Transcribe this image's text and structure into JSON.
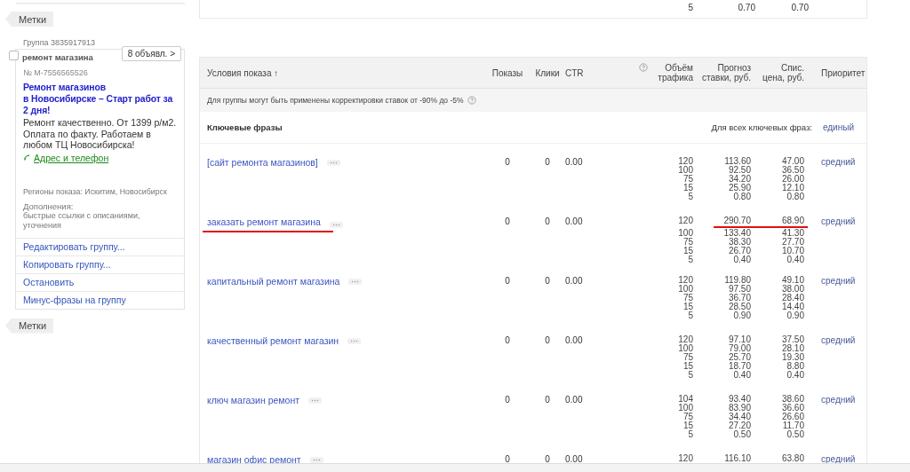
{
  "sidebar": {
    "tags_top": "Метки",
    "group": {
      "label": "Группа 3835917913",
      "name": "ремонт магазина",
      "checked": false,
      "ads_button": "8 объявл. >"
    },
    "ad": {
      "number": "№ M-7556565526",
      "title": "Ремонт магазинов\nв Новосибирске – Старт работ за 2 дня!",
      "text": "Ремонт качественно. От 1399 р/м2. Оплата по факту. Работаем в любом ТЦ Новосибирска!",
      "contact_link": "Адрес и телефон",
      "regions": "Регионы показа: Искитим, Новосибирск",
      "extras_label": "Дополнения:",
      "extras": "быстрые ссылки с описаниями, уточнения"
    },
    "menu": [
      "Редактировать группу...",
      "Копировать группу...",
      "Остановить",
      "Минус-фразы на группу"
    ],
    "tags_bottom": "Метки"
  },
  "previous_row": {
    "volume": "5",
    "bid": "0.70",
    "price": "0.70"
  },
  "table": {
    "columns": {
      "conditions": "Условия показа ↑",
      "shows": "Показы",
      "clicks": "Клики",
      "ctr": "CTR",
      "volume": "Объём трафика",
      "forecast": "Прогноз ставки, руб.",
      "price": "Спис. цена, руб.",
      "priority": "Приоритет"
    },
    "notice": "Для группы могут быть применены корректировки ставок от -90% до -5%",
    "section": "Ключевые фразы",
    "all_phrases_label": "Для всех ключевых фраз:",
    "all_phrases_priority": "единый",
    "rows": [
      {
        "phrase": "[сайт ремонта магазинов]",
        "shows": "0",
        "clicks": "0",
        "ctr": "0.00",
        "priority": "средний",
        "underlined": false,
        "bids": [
          [
            "120",
            "113.60",
            "47.00"
          ],
          [
            "100",
            "92.50",
            "36.50"
          ],
          [
            "75",
            "34.20",
            "26.00"
          ],
          [
            "15",
            "25.90",
            "12.10"
          ],
          [
            "5",
            "0.80",
            "0.80"
          ]
        ]
      },
      {
        "phrase": "заказать ремонт магазина",
        "shows": "0",
        "clicks": "0",
        "ctr": "0.00",
        "priority": "средний",
        "underlined": true,
        "bids": [
          [
            "120",
            "290.70",
            "68.90"
          ],
          [
            "100",
            "133.40",
            "41.30"
          ],
          [
            "75",
            "38.30",
            "27.70"
          ],
          [
            "15",
            "26.70",
            "10.70"
          ],
          [
            "5",
            "0.40",
            "0.40"
          ]
        ]
      },
      {
        "phrase": "капитальный ремонт магазина",
        "shows": "0",
        "clicks": "0",
        "ctr": "0.00",
        "priority": "средний",
        "underlined": false,
        "bids": [
          [
            "120",
            "119.80",
            "49.10"
          ],
          [
            "100",
            "97.50",
            "38.00"
          ],
          [
            "75",
            "36.70",
            "28.40"
          ],
          [
            "15",
            "28.50",
            "14.40"
          ],
          [
            "5",
            "0.90",
            "0.90"
          ]
        ]
      },
      {
        "phrase": "качественный ремонт магазин",
        "shows": "0",
        "clicks": "0",
        "ctr": "0.00",
        "priority": "средний",
        "underlined": false,
        "bids": [
          [
            "120",
            "97.10",
            "37.50"
          ],
          [
            "100",
            "79.00",
            "28.10"
          ],
          [
            "75",
            "25.70",
            "19.30"
          ],
          [
            "15",
            "18.70",
            "8.80"
          ],
          [
            "5",
            "0.40",
            "0.40"
          ]
        ]
      },
      {
        "phrase": "ключ магазин ремонт",
        "shows": "0",
        "clicks": "0",
        "ctr": "0.00",
        "priority": "средний",
        "underlined": false,
        "bids": [
          [
            "104",
            "93.40",
            "38.60"
          ],
          [
            "100",
            "83.90",
            "36.60"
          ],
          [
            "75",
            "34.40",
            "26.60"
          ],
          [
            "15",
            "27.20",
            "11.70"
          ],
          [
            "5",
            "0.50",
            "0.50"
          ]
        ]
      },
      {
        "phrase": "магазин офис ремонт",
        "shows": "0",
        "clicks": "0",
        "ctr": "0.00",
        "priority": "средний",
        "underlined": false,
        "bids": [
          [
            "120",
            "116.10",
            "63.80"
          ]
        ]
      }
    ]
  }
}
